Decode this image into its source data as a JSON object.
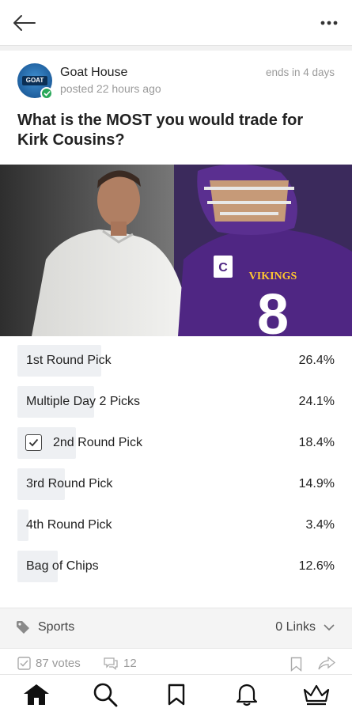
{
  "post": {
    "author": "Goat House",
    "avatar_text": "GOAT",
    "posted": "posted 22 hours ago",
    "ends": "ends in 4 days",
    "question": "What is the MOST you would trade for Kirk Cousins?"
  },
  "hero": {
    "jersey_letter": "C",
    "jersey_team": "VIKINGS",
    "jersey_number": "8"
  },
  "poll": {
    "options": [
      {
        "label": "1st Round Pick",
        "percent": "26.4%",
        "value": 26.4,
        "selected": false
      },
      {
        "label": "Multiple Day 2 Picks",
        "percent": "24.1%",
        "value": 24.1,
        "selected": false
      },
      {
        "label": "2nd Round Pick",
        "percent": "18.4%",
        "value": 18.4,
        "selected": true
      },
      {
        "label": "3rd Round Pick",
        "percent": "14.9%",
        "value": 14.9,
        "selected": false
      },
      {
        "label": "4th Round Pick",
        "percent": "3.4%",
        "value": 3.4,
        "selected": false
      },
      {
        "label": "Bag of Chips",
        "percent": "12.6%",
        "value": 12.6,
        "selected": false
      }
    ]
  },
  "tags": {
    "category": "Sports",
    "links": "0 Links"
  },
  "stats": {
    "votes": "87 votes",
    "comments": "12"
  },
  "colors": {
    "vikings_purple": "#4f2683",
    "verified_green": "#2aa85a",
    "poll_fill": "#eef0f3"
  },
  "icons": [
    "back-arrow-icon",
    "more-icon",
    "tag-icon",
    "chevron-down-icon",
    "checkbox-icon",
    "comment-icon",
    "bookmark-icon",
    "share-icon",
    "home-icon",
    "search-icon",
    "bell-icon",
    "crown-icon"
  ]
}
